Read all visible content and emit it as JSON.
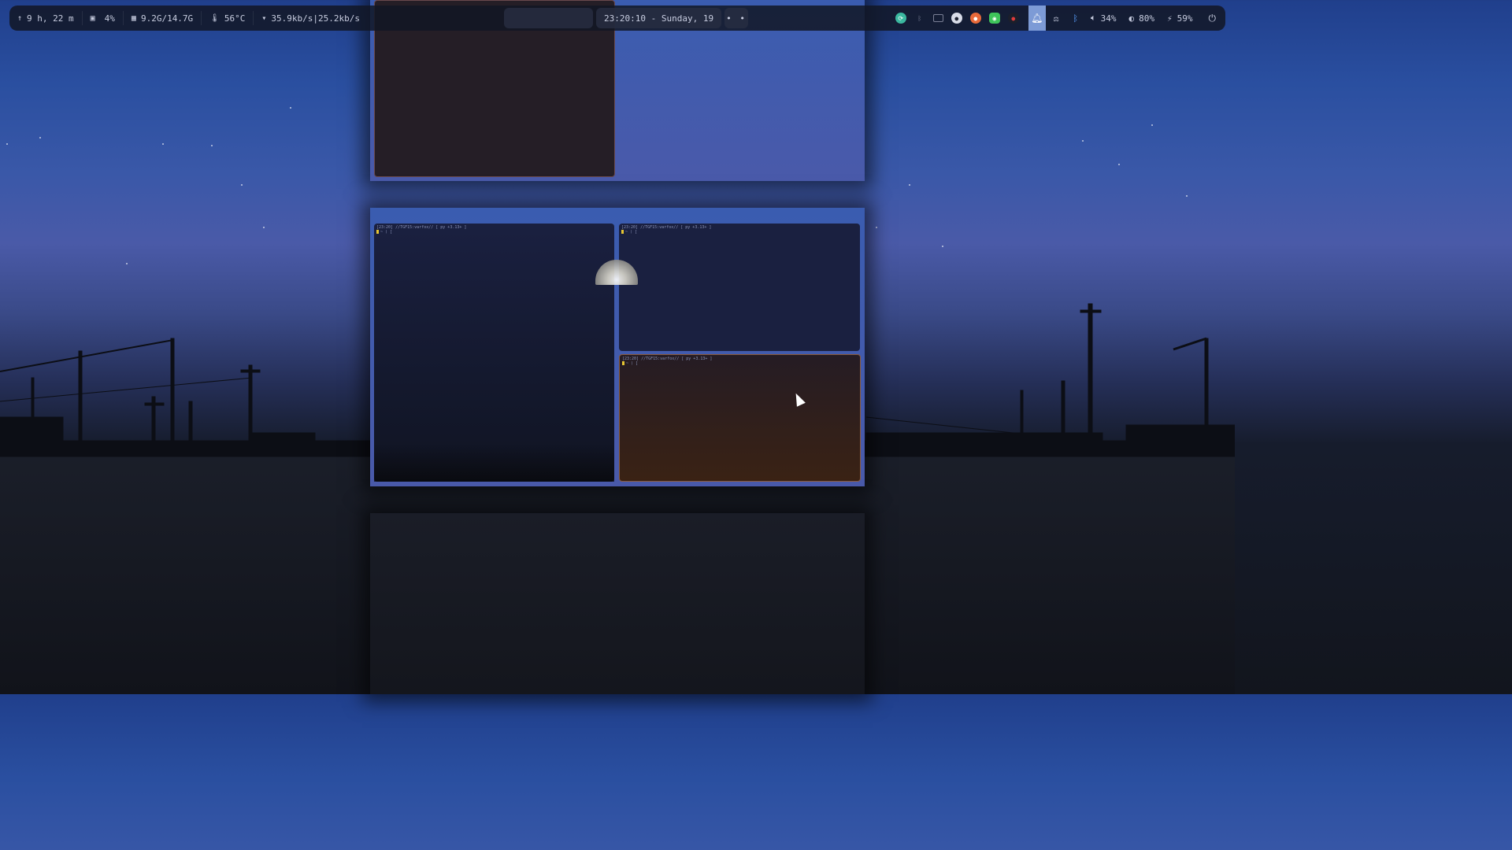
{
  "bar": {
    "uptime": "9 h, 22 m",
    "cpu": "4%",
    "memory": "9.2G/14.7G",
    "temperature": "56°C",
    "network": "35.9kb/s|25.2kb/s",
    "clock": "23:20:10 - Sunday, 19",
    "more_dots": "• •",
    "volume": "34%",
    "brightness": "80%",
    "battery": "59%"
  },
  "terminals": {
    "prompt_info": "[23:20] //TGF15:varfox// [ py +3.13+ ]",
    "prompt_line": "~ ⟩ ["
  },
  "colors": {
    "bar_bg": "#121624",
    "notify_active": "#7d9bd6",
    "terminal_focused": "#3a2214",
    "terminal_bg": "#1a2140"
  }
}
